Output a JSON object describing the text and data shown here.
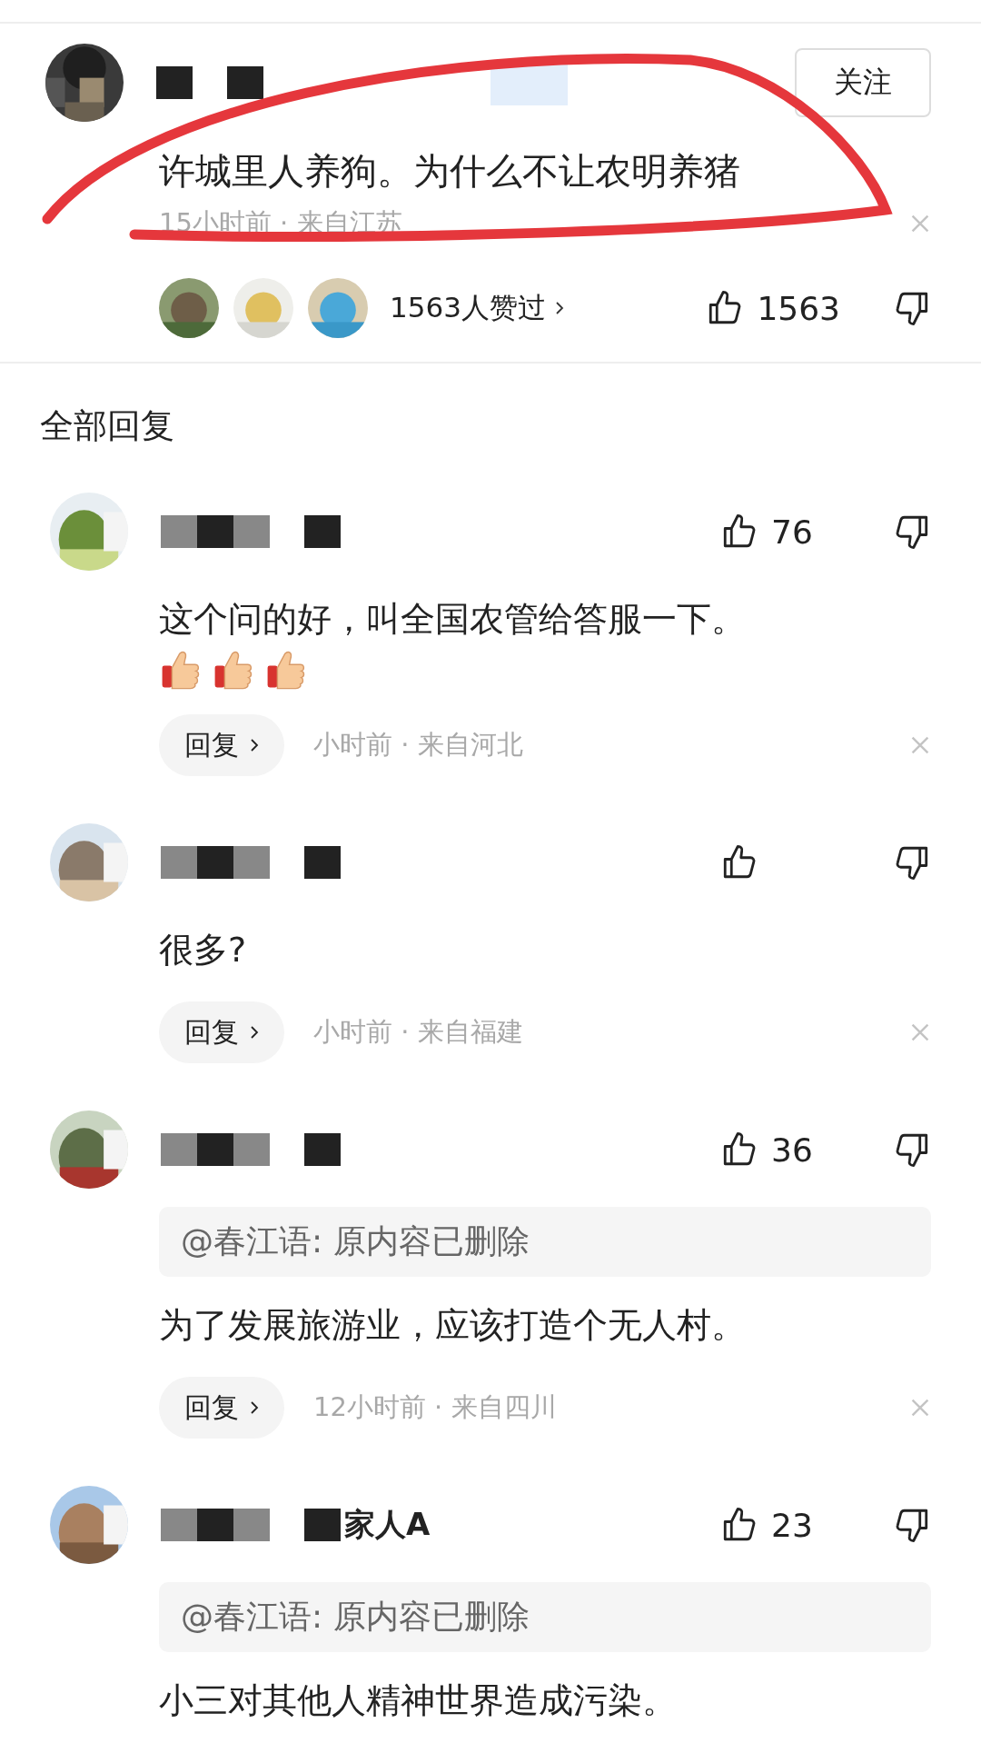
{
  "main_comment": {
    "follow_button": "关注",
    "text": "许城里人养狗。为什么不让农明养猪",
    "meta": "15小时前 · 来自江苏",
    "likers_text": "1563人赞过",
    "likes": "1563"
  },
  "section_title": "全部回复",
  "replies": [
    {
      "text": "这个问的好，叫全国农管给答服一下。",
      "reactions": [
        {
          "kind": "thumbs_up"
        },
        {
          "kind": "thumbs_up"
        },
        {
          "kind": "thumbs_up"
        }
      ],
      "likes": "76",
      "reply_button": "回复",
      "meta": "小时前 · 来自河北"
    },
    {
      "text": "很多?",
      "reply_button": "回复",
      "meta": "小时前 · 来自福建"
    },
    {
      "likes": "36",
      "quote": "@春江语: 原内容已删除",
      "text": "为了发展旅游业，应该打造个无人村。",
      "reply_button": "回复",
      "meta": "12小时前 · 来自四川"
    },
    {
      "name": "家人A",
      "likes": "23",
      "quote": "@春江语: 原内容已删除",
      "text": "小三对其他人精神世界造成污染。"
    }
  ]
}
